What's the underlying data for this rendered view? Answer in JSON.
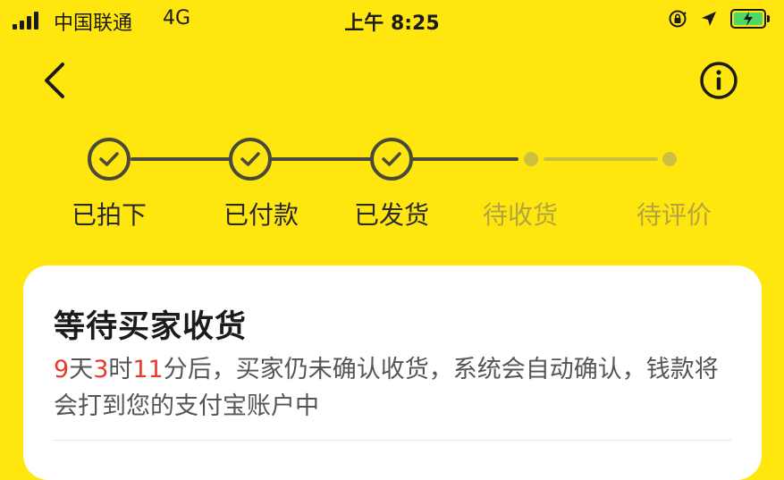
{
  "status_bar": {
    "carrier": "中国联通",
    "network": "4G",
    "time": "上午 8:25",
    "battery_color": "#4cd964"
  },
  "nav": {
    "back_icon": "chevron-left-icon",
    "info_icon": "info-circle-icon"
  },
  "progress": {
    "steps": [
      {
        "label": "已拍下",
        "done": true
      },
      {
        "label": "已付款",
        "done": true
      },
      {
        "label": "已发货",
        "done": true
      },
      {
        "label": "待收货",
        "done": false
      },
      {
        "label": "待评价",
        "done": false
      }
    ]
  },
  "card": {
    "title": "等待买家收货",
    "countdown": {
      "days": "9",
      "days_unit": "天",
      "hours": "3",
      "hours_unit": "时",
      "minutes": "11",
      "minutes_unit": "分后，",
      "message": "买家仍未确认收货，系统会自动确认，钱款将会打到您的支付宝账户中"
    }
  },
  "colors": {
    "background": "#FFE60F",
    "countdown_highlight": "#e8392e",
    "pending_step": "#b3a440"
  }
}
